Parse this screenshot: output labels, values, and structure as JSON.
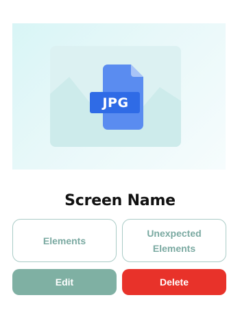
{
  "thumbnail": {
    "file_type_label": "JPG",
    "icon": "jpg-file-icon",
    "placeholder_icon": "image-placeholder-icon"
  },
  "screen": {
    "name": "Screen Name"
  },
  "cards": {
    "elements_label": "Elements",
    "unexpected_label": "Unexpected\nElements"
  },
  "actions": {
    "edit_label": "Edit",
    "delete_label": "Delete"
  },
  "colors": {
    "accent_teal": "#7fb0a3",
    "danger_red": "#e8322a",
    "card_border": "#a9cbc6",
    "card_text": "#7aa9a1",
    "file_icon_blue": "#2f6be6"
  }
}
